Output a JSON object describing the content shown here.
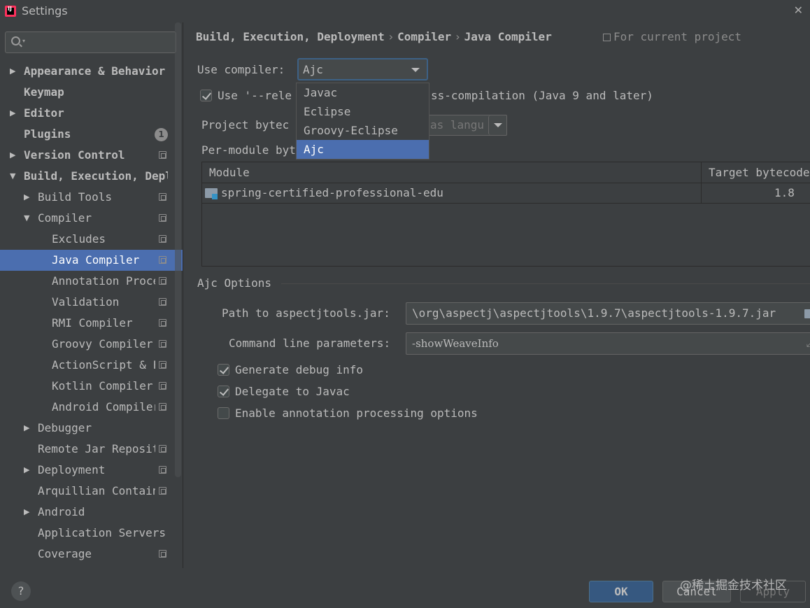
{
  "window": {
    "title": "Settings",
    "logo_text": "IJ",
    "close_glyph": "✕"
  },
  "sidebar": {
    "search_placeholder": "",
    "items": [
      {
        "label": "Appearance & Behavior",
        "level": 0,
        "arrow": "right",
        "bold": true
      },
      {
        "label": "Keymap",
        "level": 0,
        "arrow": "none",
        "bold": true
      },
      {
        "label": "Editor",
        "level": 0,
        "arrow": "right",
        "bold": true
      },
      {
        "label": "Plugins",
        "level": 0,
        "arrow": "none",
        "bold": true,
        "badge": "1"
      },
      {
        "label": "Version Control",
        "level": 0,
        "arrow": "right",
        "bold": true,
        "project": true
      },
      {
        "label": "Build, Execution, Deployment",
        "level": 0,
        "arrow": "down",
        "bold": true
      },
      {
        "label": "Build Tools",
        "level": 1,
        "arrow": "right",
        "project": true
      },
      {
        "label": "Compiler",
        "level": 1,
        "arrow": "down",
        "project": true
      },
      {
        "label": "Excludes",
        "level": 2,
        "arrow": "none",
        "project": true
      },
      {
        "label": "Java Compiler",
        "level": 2,
        "arrow": "none",
        "project": true,
        "selected": true
      },
      {
        "label": "Annotation Processors",
        "level": 2,
        "arrow": "none",
        "project": true
      },
      {
        "label": "Validation",
        "level": 2,
        "arrow": "none",
        "project": true
      },
      {
        "label": "RMI Compiler",
        "level": 2,
        "arrow": "none",
        "project": true
      },
      {
        "label": "Groovy Compiler",
        "level": 2,
        "arrow": "none",
        "project": true
      },
      {
        "label": "ActionScript & Flex Compiler",
        "level": 2,
        "arrow": "none",
        "project": true
      },
      {
        "label": "Kotlin Compiler",
        "level": 2,
        "arrow": "none",
        "project": true
      },
      {
        "label": "Android Compiler",
        "level": 2,
        "arrow": "none",
        "project": true
      },
      {
        "label": "Debugger",
        "level": 1,
        "arrow": "right"
      },
      {
        "label": "Remote Jar Repositories",
        "level": 1,
        "arrow": "none",
        "project": true
      },
      {
        "label": "Deployment",
        "level": 1,
        "arrow": "right",
        "project": true
      },
      {
        "label": "Arquillian Containers",
        "level": 1,
        "arrow": "none",
        "project": true
      },
      {
        "label": "Android",
        "level": 1,
        "arrow": "right"
      },
      {
        "label": "Application Servers",
        "level": 1,
        "arrow": "none"
      },
      {
        "label": "Coverage",
        "level": 1,
        "arrow": "none",
        "project": true
      }
    ]
  },
  "breadcrumb": {
    "parts": [
      "Build, Execution, Deployment",
      "Compiler",
      "Java Compiler"
    ],
    "separator": "›",
    "scope": "For current project"
  },
  "compiler": {
    "label": "Use compiler:",
    "selected": "Ajc",
    "options": [
      "Javac",
      "Eclipse",
      "Groovy-Eclipse",
      "Ajc"
    ]
  },
  "release_option": {
    "checked": true,
    "label_start": "Use '--rele",
    "label_end": "ss-compilation (Java 9 and later)"
  },
  "bytecode": {
    "project_label": "Project bytec",
    "project_value": "as langu",
    "per_module_label": "Per-module byt"
  },
  "module_table": {
    "columns": [
      "Module",
      "Target bytecode"
    ],
    "rows": [
      {
        "module": "spring-certified-professional-edu",
        "target": "1.8"
      }
    ]
  },
  "ajc": {
    "title": "Ajc Options",
    "path_label": "Path to aspectjtools.jar:",
    "path_value": "\\org\\aspectj\\aspectjtools\\1.9.7\\aspectjtools-1.9.7.jar",
    "cmd_label": "Command line parameters:",
    "cmd_value": "-showWeaveInfo",
    "checkboxes": [
      {
        "label": "Generate debug info",
        "checked": true
      },
      {
        "label": "Delegate to Javac",
        "checked": true
      },
      {
        "label": "Enable annotation processing options",
        "checked": false
      }
    ]
  },
  "footer": {
    "help": "?",
    "ok": "OK",
    "cancel": "Cancel",
    "apply": "Apply",
    "watermark": "@稀土掘金技术社区"
  },
  "colors": {
    "background": "#3c3f41",
    "selection": "#4b6eaf",
    "ok_button": "#365880",
    "focus_border": "#3d6185"
  }
}
